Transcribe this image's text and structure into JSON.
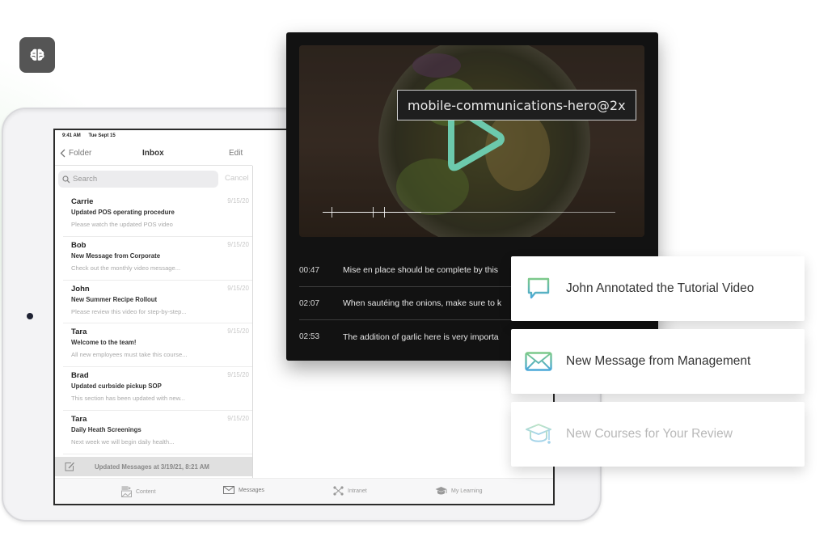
{
  "brand_badge": {
    "icon": "brain-icon"
  },
  "tablet": {
    "status_bar": {
      "time": "9:41 AM",
      "date": "Tue Sept 15"
    },
    "nav": {
      "back_label": "Folder",
      "title": "Inbox",
      "edit_label": "Edit"
    },
    "search": {
      "placeholder": "Search",
      "cancel_label": "Cancel"
    },
    "messages": [
      {
        "sender": "Carrie",
        "subject": "Updated POS operating procedure",
        "preview": "Please watch the updated POS video",
        "date": "9/15/20"
      },
      {
        "sender": "Bob",
        "subject": "New Message from Corporate",
        "preview": "Check out the monthly video message...",
        "date": "9/15/20"
      },
      {
        "sender": "John",
        "subject": "New Summer Recipe Rollout",
        "preview": "Please review this video for step-by-step...",
        "date": "9/15/20"
      },
      {
        "sender": "Tara",
        "subject": "Welcome to the team!",
        "preview": "All new employees must take this course...",
        "date": "9/15/20"
      },
      {
        "sender": "Brad",
        "subject": "Updated curbside pickup SOP",
        "preview": "This section has been updated with new...",
        "date": "9/15/20"
      },
      {
        "sender": "Tara",
        "subject": "Daily Heath Screenings",
        "preview": "Next week we will begin daily health...",
        "date": "9/15/20"
      }
    ],
    "update_status": "Updated Messages at 3/19/21, 8:21 AM",
    "tabs": [
      {
        "label": "Content",
        "icon": "content-icon"
      },
      {
        "label": "Messages",
        "icon": "envelope-icon"
      },
      {
        "label": "Intranet",
        "icon": "network-icon"
      },
      {
        "label": "My Learning",
        "icon": "graduation-cap-icon"
      }
    ]
  },
  "video": {
    "filename_tooltip": "mobile-communications-hero@2x",
    "accent_color": "#6cc9ac",
    "annotations": [
      {
        "time": "00:47",
        "text": "Mise en place should be complete by this"
      },
      {
        "time": "02:07",
        "text": "When sautéing the onions, make sure to k"
      },
      {
        "time": "02:53",
        "text": "The addition of garlic here is very importa"
      }
    ]
  },
  "notifications": [
    {
      "icon": "chat-bubble-icon",
      "text": "John Annotated the Tutorial Video"
    },
    {
      "icon": "envelope-icon",
      "text": "New Message from Management"
    },
    {
      "icon": "graduation-cap-icon",
      "text": "New Courses for Your Review"
    }
  ]
}
